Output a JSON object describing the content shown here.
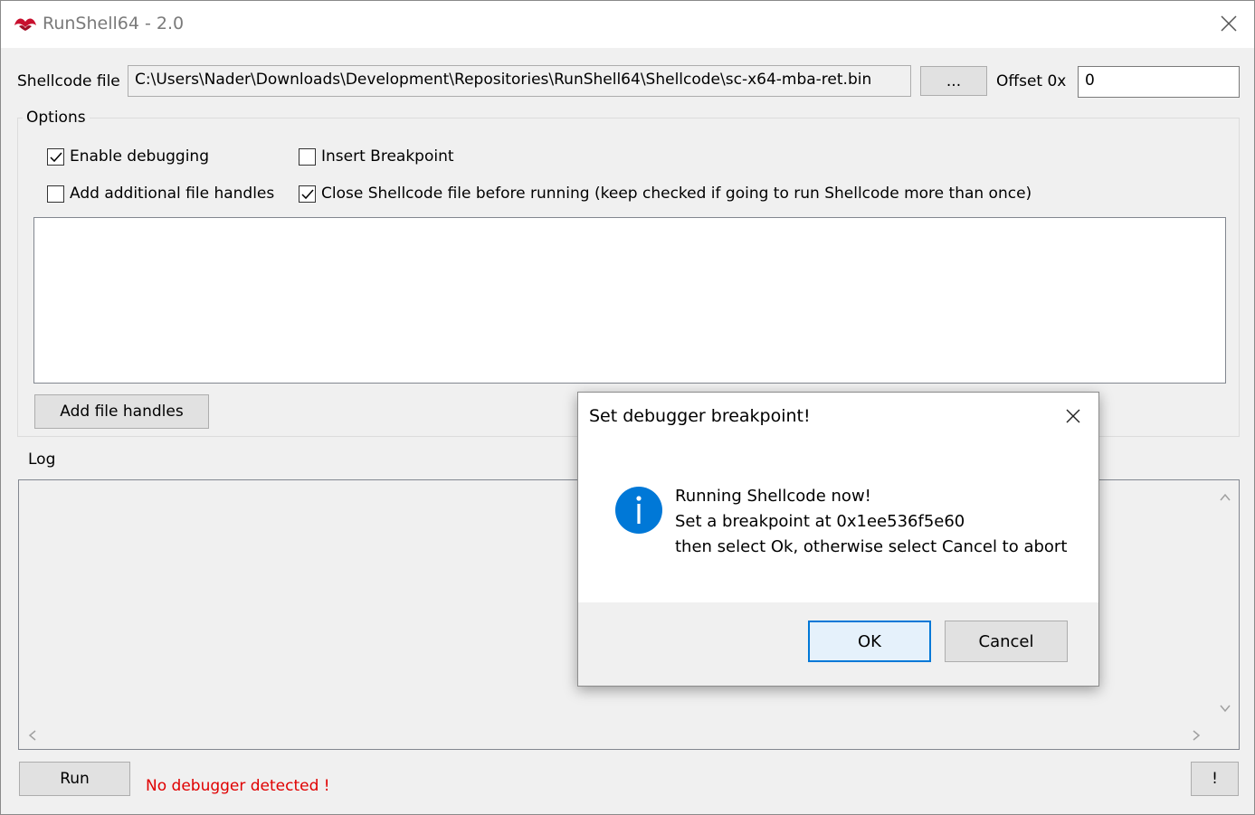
{
  "window": {
    "title": "RunShell64 - 2.0",
    "app_icon": "runshell-logo-icon",
    "close_icon": "close-icon"
  },
  "file_row": {
    "label": "Shellcode file",
    "path_value": "C:\\Users\\Nader\\Downloads\\Development\\Repositories\\RunShell64\\Shellcode\\sc-x64-mba-ret.bin",
    "browse_label": "...",
    "offset_label": "Offset 0x",
    "offset_value": "0"
  },
  "options": {
    "title": "Options",
    "checkboxes": [
      {
        "label": "Enable debugging",
        "checked": true
      },
      {
        "label": "Insert Breakpoint",
        "checked": false
      },
      {
        "label": "Add additional file handles",
        "checked": false
      },
      {
        "label": "Close Shellcode file before running (keep checked if going to run Shellcode more than once)",
        "checked": true
      }
    ],
    "add_handles_label": "Add file handles"
  },
  "log": {
    "title": "Log"
  },
  "footer": {
    "run_label": "Run",
    "status_text": "No debugger detected !",
    "status_color": "#e00000",
    "about_label": "!"
  },
  "dialog": {
    "title": "Set debugger breakpoint!",
    "icon": "info-icon",
    "lines": [
      "Running Shellcode now!",
      "Set a breakpoint at 0x1ee536f5e60",
      "then select Ok, otherwise select Cancel to abort"
    ],
    "ok_label": "OK",
    "cancel_label": "Cancel",
    "accent_color": "#0078d7"
  }
}
